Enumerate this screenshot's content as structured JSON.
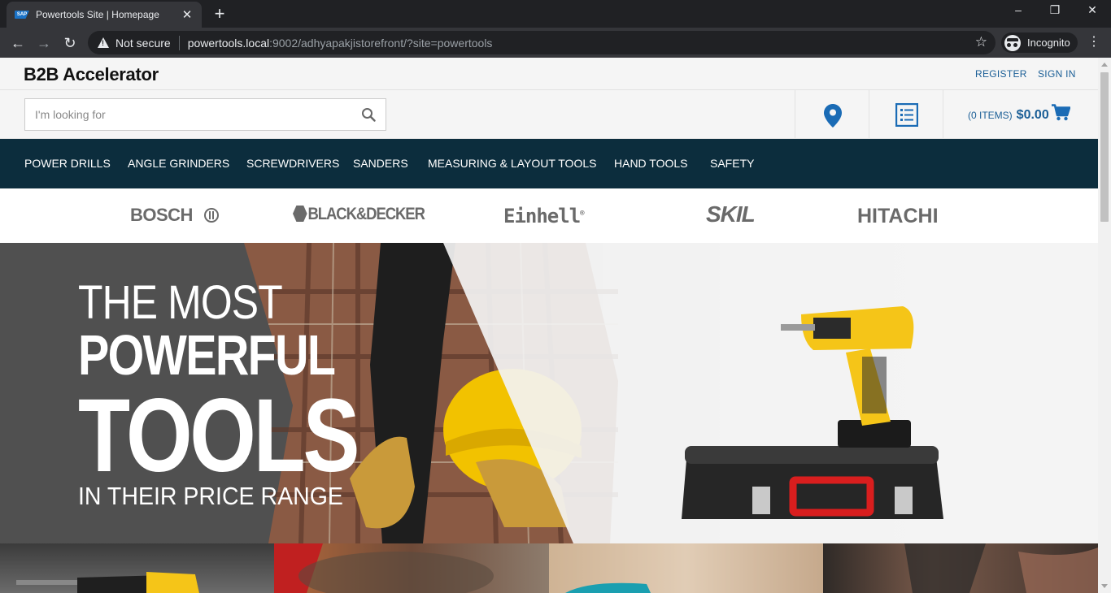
{
  "browser": {
    "tab_title": "Powertools Site | Homepage",
    "favicon_text": "SAP",
    "security_label": "Not secure",
    "url_host": "powertools.local",
    "url_rest": ":9002/adhyapakjistorefront/?site=powertools",
    "incognito_label": "Incognito"
  },
  "header": {
    "brand": "B2B Accelerator",
    "register": "REGISTER",
    "sign_in": "SIGN IN"
  },
  "search": {
    "placeholder": "I'm looking for"
  },
  "cart": {
    "count_label": "(0 ITEMS)",
    "total": "$0.00"
  },
  "categories": [
    "POWER DRILLS",
    "ANGLE GRINDERS",
    "SCREWDRIVERS",
    "SANDERS",
    "MEASURING & LAYOUT TOOLS",
    "HAND TOOLS",
    "SAFETY"
  ],
  "brands": [
    "BOSCH",
    "BLACK&DECKER",
    "Einhell",
    "SKIL",
    "HITACHI"
  ],
  "hero": {
    "line1": "THE MOST",
    "line2": "POWERFUL",
    "line3": "TOOLS",
    "line4": "IN THEIR PRICE RANGE"
  },
  "colors": {
    "nav_bg": "#0c2d3d",
    "link": "#1a5e96",
    "drill_yellow": "#f5c518"
  }
}
